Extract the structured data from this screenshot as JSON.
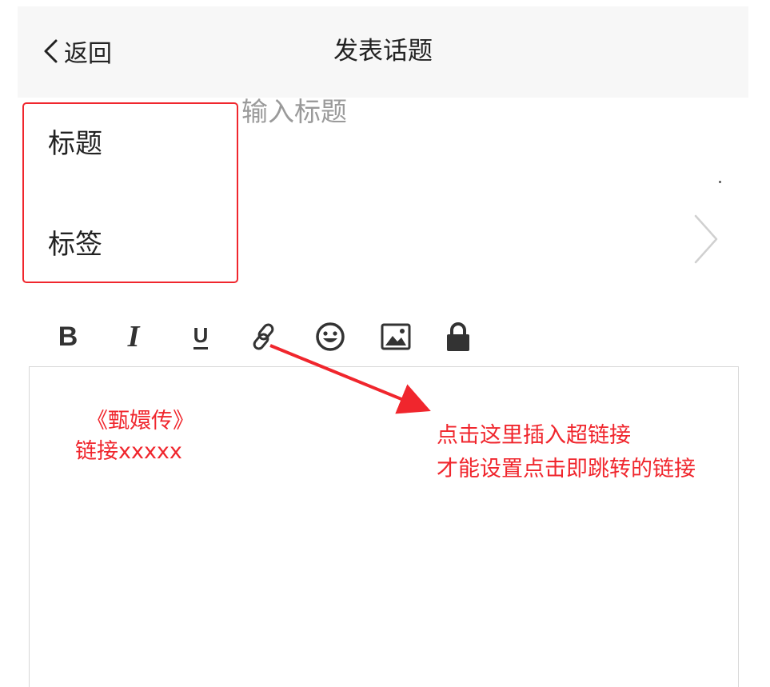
{
  "header": {
    "back_label": "返回",
    "title": "发表话题"
  },
  "form": {
    "title_label": "标题",
    "title_placeholder": "输入标题",
    "tags_label": "标签"
  },
  "toolbar": {
    "items": [
      {
        "name": "bold",
        "glyph": "B"
      },
      {
        "name": "italic",
        "glyph": "I"
      },
      {
        "name": "underline",
        "glyph": "U"
      },
      {
        "name": "link-icon"
      },
      {
        "name": "emoji-icon"
      },
      {
        "name": "image-icon"
      },
      {
        "name": "lock-icon"
      }
    ]
  },
  "annotations": {
    "editor_note_line1": "《甄嬛传》",
    "editor_note_line2": "链接xxxxx",
    "tip_line1": "点击这里插入超链接",
    "tip_line2": "才能设置点击即跳转的链接"
  },
  "colors": {
    "annotation_red": "#f0262d",
    "header_bg": "#f7f7f7",
    "text_dark": "#222222",
    "placeholder_gray": "#9a9a9a"
  }
}
